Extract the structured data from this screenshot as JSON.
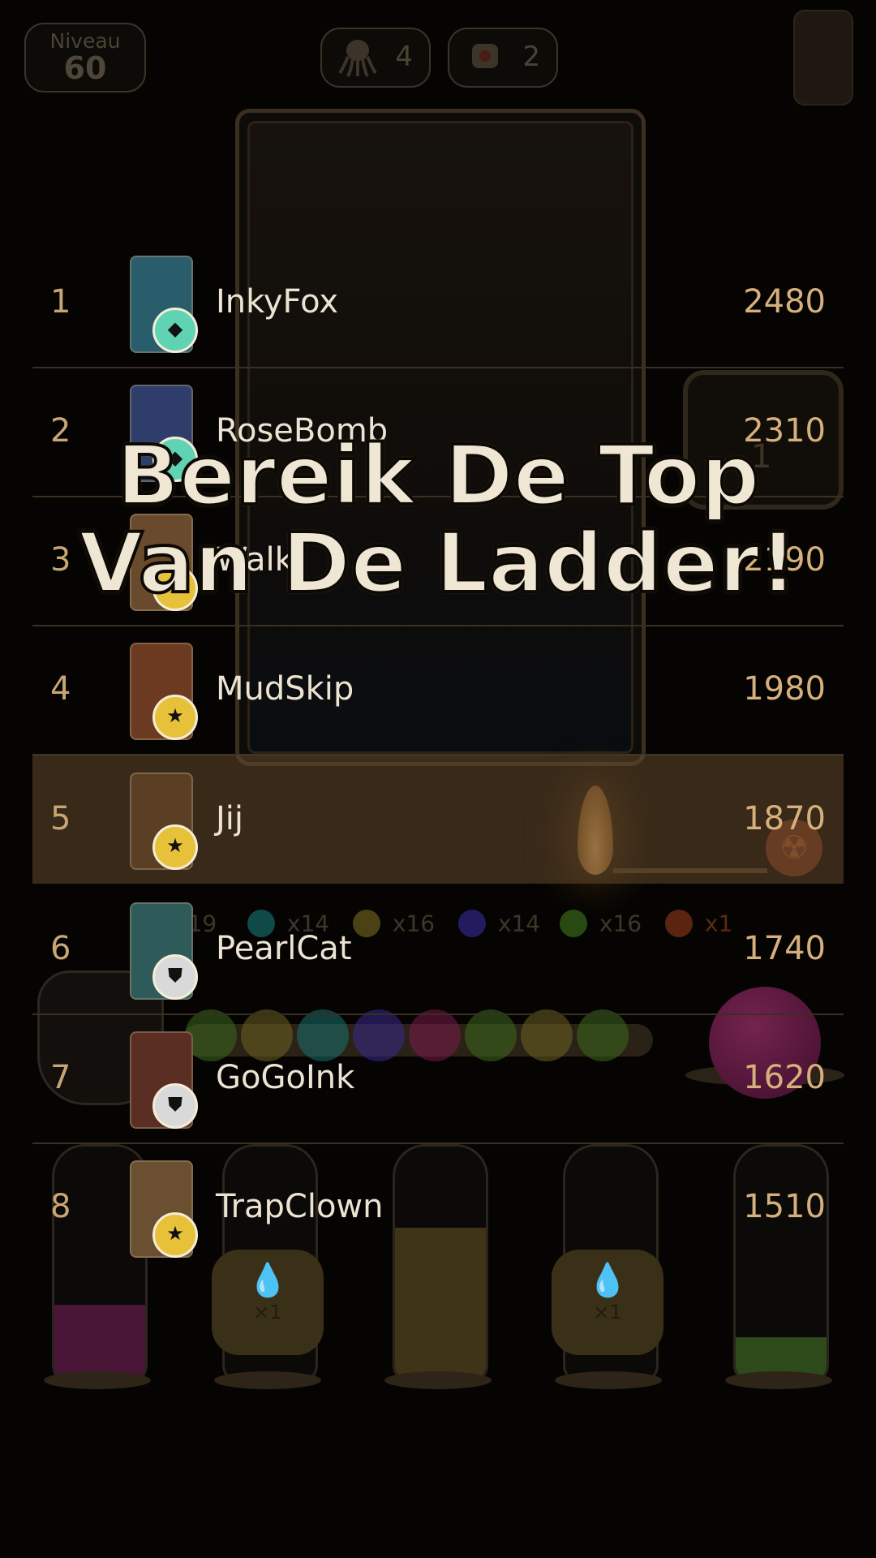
{
  "hud": {
    "level_label": "Niveau",
    "level_value": "60",
    "counter_a": "4",
    "counter_b": "2"
  },
  "game": {
    "side_box_value": "1",
    "ball_counts": [
      {
        "text": "x19",
        "color": "#1c1c3a"
      },
      {
        "text": "x14",
        "color": "#0f4a48"
      },
      {
        "text": "x16",
        "color": "#4a4214"
      },
      {
        "text": "x14",
        "color": "#221c5e"
      },
      {
        "text": "x16",
        "color": "#284a12"
      },
      {
        "text": "x1",
        "color": "#5a2410"
      }
    ],
    "potion_count": "×1"
  },
  "leaderboard": [
    {
      "rank": "1",
      "name": "InkyFox",
      "score": "2480",
      "badge": "diamond",
      "portrait": "#2a5d6b"
    },
    {
      "rank": "2",
      "name": "RoseBomb",
      "score": "2310",
      "badge": "diamond",
      "portrait": "#2e3d6a"
    },
    {
      "rank": "3",
      "name": "Walk",
      "score": "2190",
      "badge": "star",
      "portrait": "#6a4a2c"
    },
    {
      "rank": "4",
      "name": "MudSkip",
      "score": "1980",
      "badge": "star",
      "portrait": "#6b3a20"
    },
    {
      "rank": "5",
      "name": "Jij",
      "score": "1870",
      "badge": "star",
      "portrait": "#5a3f24"
    },
    {
      "rank": "6",
      "name": "PearlCat",
      "score": "1740",
      "badge": "shield",
      "portrait": "#2f5a5a"
    },
    {
      "rank": "7",
      "name": "GoGoInk",
      "score": "1620",
      "badge": "shield",
      "portrait": "#5a2e22"
    },
    {
      "rank": "8",
      "name": "TrapClown",
      "score": "1510",
      "badge": "star",
      "portrait": "#6a5030"
    }
  ],
  "promo": {
    "line1": "Bereik De Top",
    "line2": "Van De Ladder!"
  },
  "colors": {
    "accent_gold": "#d6b07c",
    "highlight_row": "#62482c"
  }
}
